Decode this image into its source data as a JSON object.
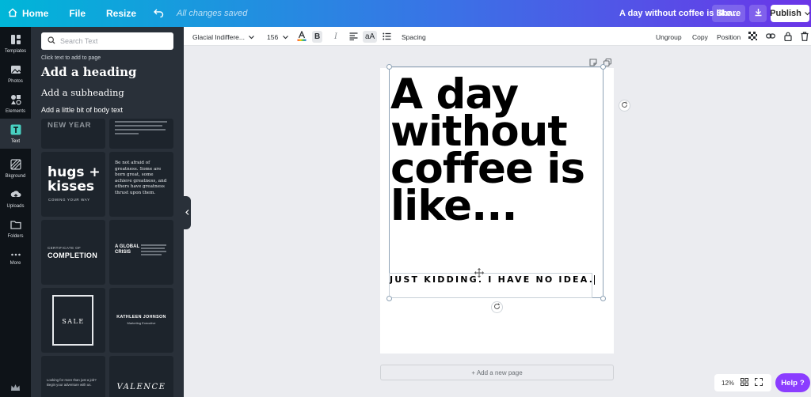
{
  "topbar": {
    "home_label": "Home",
    "file_label": "File",
    "resize_label": "Resize",
    "save_status": "All changes saved",
    "doc_title": "A day without coffee is like...",
    "share_label": "Share",
    "publish_label": "Publish"
  },
  "rail": {
    "templates": "Templates",
    "photos": "Photos",
    "elements": "Elements",
    "text": "Text",
    "background": "Bkground",
    "uploads": "Uploads",
    "folders": "Folders",
    "more": "More"
  },
  "panel": {
    "search_placeholder": "Search Text",
    "hint": "Click text to add to page",
    "add_heading": "Add a heading",
    "add_subheading": "Add a subheading",
    "add_body": "Add a little bit of body text",
    "tiles": {
      "newyear": "NEW YEAR",
      "hugs": "hugs +\nkisses",
      "hugs_sub": "COMING YOUR WAY",
      "quote": "Be not afraid of greatness. Some are born great, some achieve greatness, and others have greatness thrust upon them.",
      "cert_top": "CERTIFICATE OF",
      "cert_main": "COMPLETION",
      "crisis": "A GLOBAL\nCRISIS",
      "sale": "SALE",
      "name": "KATHLEEN JOHNSON",
      "name_sub": "Marketing Executive",
      "valence": "VALENCE",
      "looking": "Looking for more than just a job? Begin your adventure with us."
    }
  },
  "toolbar": {
    "font": "Glacial Indiffere...",
    "size": "156",
    "bold": "B",
    "italic": "I",
    "case": "aA",
    "spacing": "Spacing",
    "ungroup": "Ungroup",
    "copy": "Copy",
    "position": "Position"
  },
  "canvas": {
    "headline": "A day without coffee is like...",
    "subline": "JUST KIDDING. I HAVE NO IDEA.",
    "add_page": "+ Add a new page"
  },
  "footer": {
    "zoom": "12%",
    "help": "Help",
    "help_icon": "?"
  },
  "colors": {
    "accent_purple": "#8b3dff",
    "panel_bg": "#293039",
    "rail_bg": "#0e1318",
    "text_active": "#48d0c1"
  }
}
